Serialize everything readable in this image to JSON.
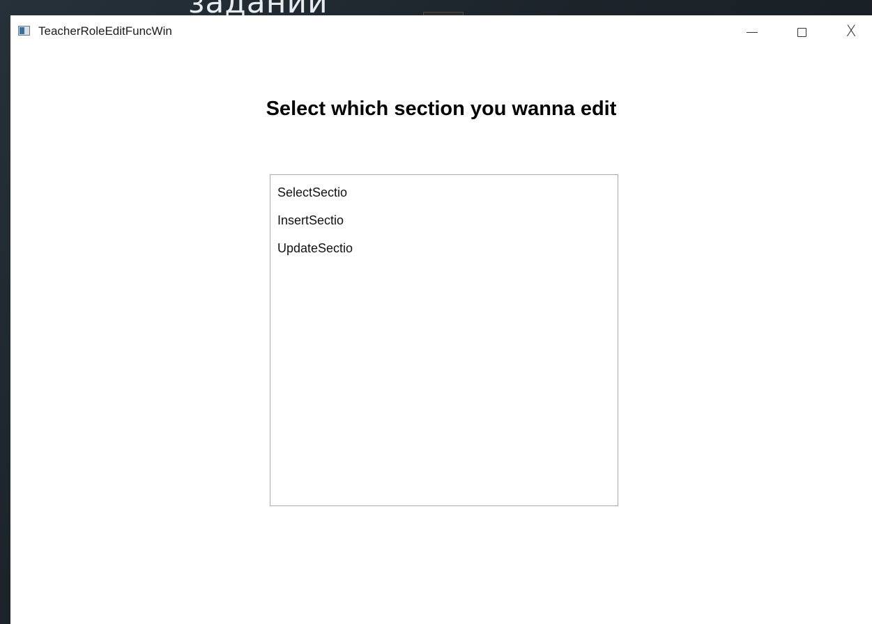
{
  "background": {
    "text": "задании"
  },
  "window": {
    "title": "TeacherRoleEditFuncWin",
    "caption_buttons": {
      "minimize_icon": "minimize-icon",
      "maximize_icon": "maximize-icon",
      "close_icon": "close-icon",
      "close_glyph": "X"
    }
  },
  "main": {
    "heading": "Select which section you wanna edit",
    "list_items": [
      {
        "label": "SelectSectio"
      },
      {
        "label": "InsertSectio"
      },
      {
        "label": "UpdateSectio"
      }
    ]
  },
  "colors": {
    "window_background": "#ffffff",
    "desktop_background": "#1c2329",
    "listbox_border": "#ababab"
  }
}
